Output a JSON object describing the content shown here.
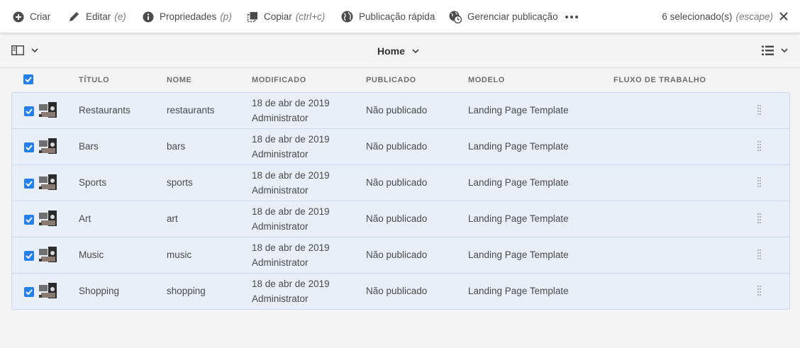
{
  "toolbar": {
    "create_label": "Criar",
    "edit_label": "Editar",
    "edit_key": "(e)",
    "properties_label": "Propriedades",
    "properties_key": "(p)",
    "copy_label": "Copiar",
    "copy_key": "(ctrl+c)",
    "quick_publish_label": "Publicação rápida",
    "manage_publication_label": "Gerenciar publicação",
    "selection_count": "6 selecionado(s)",
    "selection_key": "(escape)"
  },
  "subbar": {
    "title": "Home"
  },
  "columns": {
    "title": "TÍTULO",
    "name": "NOME",
    "modified": "MODIFICADO",
    "published": "PUBLICADO",
    "template": "MODELO",
    "workflow": "FLUXO DE TRABALHO"
  },
  "rows": [
    {
      "title": "Restaurants",
      "name": "restaurants",
      "modified_date": "18 de abr de 2019",
      "modified_by": "Administrator",
      "published": "Não publicado",
      "template": "Landing Page Template"
    },
    {
      "title": "Bars",
      "name": "bars",
      "modified_date": "18 de abr de 2019",
      "modified_by": "Administrator",
      "published": "Não publicado",
      "template": "Landing Page Template"
    },
    {
      "title": "Sports",
      "name": "sports",
      "modified_date": "18 de abr de 2019",
      "modified_by": "Administrator",
      "published": "Não publicado",
      "template": "Landing Page Template"
    },
    {
      "title": "Art",
      "name": "art",
      "modified_date": "18 de abr de 2019",
      "modified_by": "Administrator",
      "published": "Não publicado",
      "template": "Landing Page Template"
    },
    {
      "title": "Music",
      "name": "music",
      "modified_date": "18 de abr de 2019",
      "modified_by": "Administrator",
      "published": "Não publicado",
      "template": "Landing Page Template"
    },
    {
      "title": "Shopping",
      "name": "shopping",
      "modified_date": "18 de abr de 2019",
      "modified_by": "Administrator",
      "published": "Não publicado",
      "template": "Landing Page Template"
    }
  ],
  "colors": {
    "checkbox_blue": "#2680eb",
    "selected_row_bg": "#e8eff9",
    "page_bg": "#f4f4f4"
  },
  "icons": {
    "create": "plus-circle-icon",
    "edit": "pencil-icon",
    "properties": "info-icon",
    "copy": "copy-icon",
    "quick_publish": "globe-icon",
    "manage_publication": "globe-clock-icon",
    "more": "more-icon",
    "close": "close-icon",
    "rail": "rail-icon",
    "view": "list-view-icon"
  }
}
